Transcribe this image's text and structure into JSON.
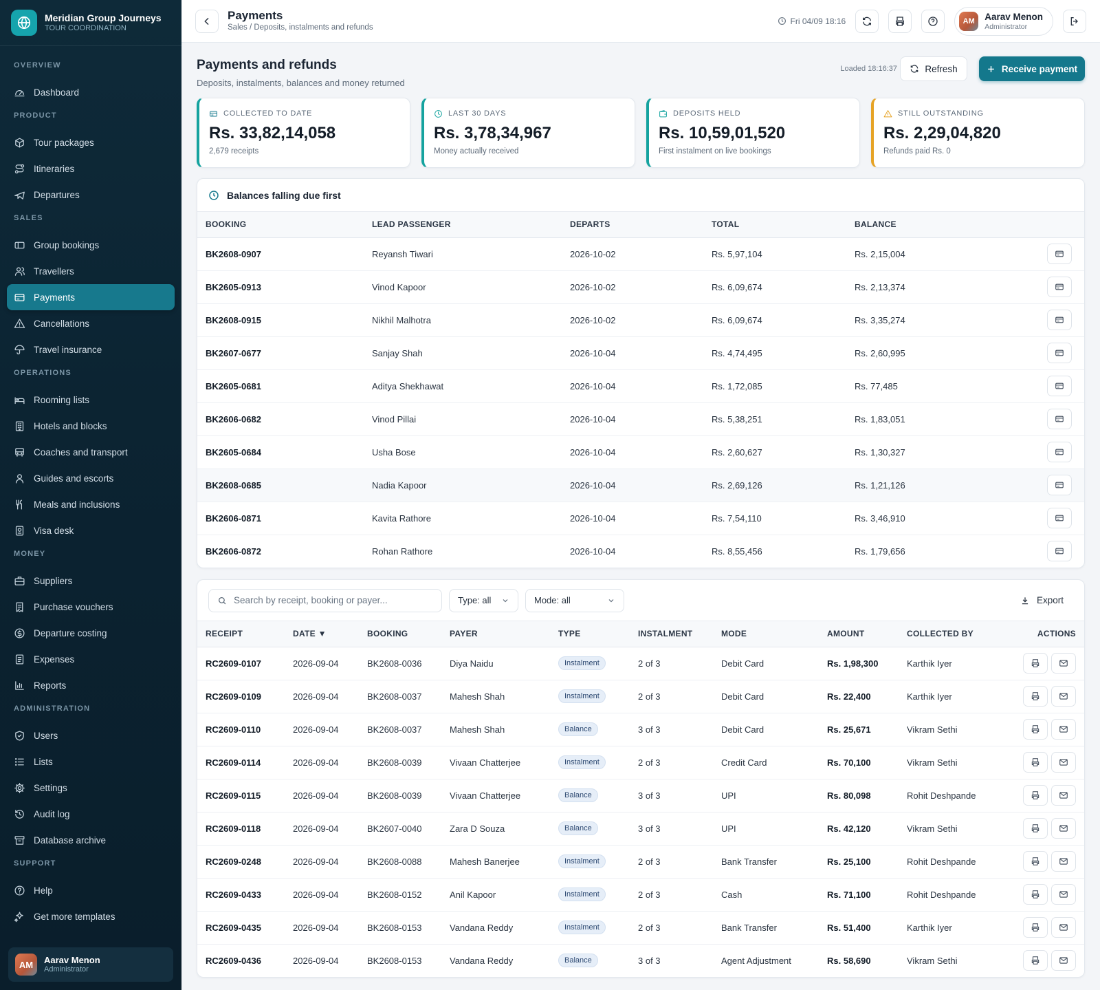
{
  "brand": {
    "name": "Meridian Group Journeys",
    "subtitle": "TOUR COORDINATION"
  },
  "sidebar": {
    "sections": [
      {
        "title": "OVERVIEW",
        "items": [
          {
            "label": "Dashboard",
            "icon": "dashboard-icon"
          }
        ]
      },
      {
        "title": "PRODUCT",
        "items": [
          {
            "label": "Tour packages",
            "icon": "package-icon"
          },
          {
            "label": "Itineraries",
            "icon": "route-icon"
          },
          {
            "label": "Departures",
            "icon": "plane-icon"
          }
        ]
      },
      {
        "title": "SALES",
        "items": [
          {
            "label": "Group bookings",
            "icon": "ticket-icon"
          },
          {
            "label": "Travellers",
            "icon": "users-icon"
          },
          {
            "label": "Payments",
            "icon": "card-icon",
            "active": true
          },
          {
            "label": "Cancellations",
            "icon": "alert-icon"
          },
          {
            "label": "Travel insurance",
            "icon": "umbrella-icon"
          }
        ]
      },
      {
        "title": "OPERATIONS",
        "items": [
          {
            "label": "Rooming lists",
            "icon": "bed-icon"
          },
          {
            "label": "Hotels and blocks",
            "icon": "building-icon"
          },
          {
            "label": "Coaches and transport",
            "icon": "bus-icon"
          },
          {
            "label": "Guides and escorts",
            "icon": "user-icon"
          },
          {
            "label": "Meals and inclusions",
            "icon": "utensils-icon"
          },
          {
            "label": "Visa desk",
            "icon": "passport-icon"
          }
        ]
      },
      {
        "title": "MONEY",
        "items": [
          {
            "label": "Suppliers",
            "icon": "briefcase-icon"
          },
          {
            "label": "Purchase vouchers",
            "icon": "receipt-icon"
          },
          {
            "label": "Departure costing",
            "icon": "coin-icon"
          },
          {
            "label": "Expenses",
            "icon": "document-icon"
          },
          {
            "label": "Reports",
            "icon": "chart-icon"
          }
        ]
      },
      {
        "title": "ADMINISTRATION",
        "items": [
          {
            "label": "Users",
            "icon": "shield-icon"
          },
          {
            "label": "Lists",
            "icon": "list-icon"
          },
          {
            "label": "Settings",
            "icon": "gear-icon"
          },
          {
            "label": "Audit log",
            "icon": "history-icon"
          },
          {
            "label": "Database archive",
            "icon": "archive-icon"
          }
        ]
      },
      {
        "title": "SUPPORT",
        "items": [
          {
            "label": "Help",
            "icon": "help-icon"
          },
          {
            "label": "Get more templates",
            "icon": "sparkle-icon"
          }
        ]
      }
    ]
  },
  "user": {
    "name": "Aarav Menon",
    "role": "Administrator",
    "initials": "AM"
  },
  "topbar": {
    "title": "Payments",
    "breadcrumb": "Sales / Deposits, instalments and refunds",
    "datetime": "Fri 04/09 18:16"
  },
  "page": {
    "title": "Payments and refunds",
    "subtitle": "Deposits, instalments, balances and money returned",
    "loaded": "Loaded 18:16:37",
    "refresh_label": "Refresh",
    "primary_label": "Receive payment"
  },
  "stats": [
    {
      "label": "COLLECTED TO DATE",
      "value": "Rs. 33,82,14,058",
      "note": "2,679 receipts",
      "icon": "card-icon"
    },
    {
      "label": "LAST 30 DAYS",
      "value": "Rs. 3,78,34,967",
      "note": "Money actually received",
      "icon": "clock-icon"
    },
    {
      "label": "DEPOSITS HELD",
      "value": "Rs. 10,59,01,520",
      "note": "First instalment on live bookings",
      "icon": "wallet-icon"
    },
    {
      "label": "STILL OUTSTANDING",
      "value": "Rs. 2,29,04,820",
      "note": "Refunds paid Rs. 0",
      "icon": "warning-icon"
    }
  ],
  "due": {
    "title": "Balances falling due first",
    "columns": [
      "BOOKING",
      "LEAD PASSENGER",
      "DEPARTS",
      "TOTAL",
      "BALANCE",
      ""
    ],
    "rows": [
      [
        "BK2608-0907",
        "Reyansh Tiwari",
        "2026-10-02",
        "Rs. 5,97,104",
        "Rs. 2,15,004"
      ],
      [
        "BK2605-0913",
        "Vinod Kapoor",
        "2026-10-02",
        "Rs. 6,09,674",
        "Rs. 2,13,374"
      ],
      [
        "BK2608-0915",
        "Nikhil Malhotra",
        "2026-10-02",
        "Rs. 6,09,674",
        "Rs. 3,35,274"
      ],
      [
        "BK2607-0677",
        "Sanjay Shah",
        "2026-10-04",
        "Rs. 4,74,495",
        "Rs. 2,60,995"
      ],
      [
        "BK2605-0681",
        "Aditya Shekhawat",
        "2026-10-04",
        "Rs. 1,72,085",
        "Rs. 77,485"
      ],
      [
        "BK2606-0682",
        "Vinod Pillai",
        "2026-10-04",
        "Rs. 5,38,251",
        "Rs. 1,83,051"
      ],
      [
        "BK2605-0684",
        "Usha Bose",
        "2026-10-04",
        "Rs. 2,60,627",
        "Rs. 1,30,327"
      ],
      [
        "BK2608-0685",
        "Nadia Kapoor",
        "2026-10-04",
        "Rs. 2,69,126",
        "Rs. 1,21,126"
      ],
      [
        "BK2606-0871",
        "Kavita Rathore",
        "2026-10-04",
        "Rs. 7,54,110",
        "Rs. 3,46,910"
      ],
      [
        "BK2606-0872",
        "Rohan Rathore",
        "2026-10-04",
        "Rs. 8,55,456",
        "Rs. 1,79,656"
      ]
    ]
  },
  "filters": {
    "search_placeholder": "Search by receipt, booking or payer...",
    "type": "Type: all",
    "mode": "Mode: all",
    "export_label": "Export"
  },
  "payments": {
    "columns": [
      "RECEIPT",
      "DATE ▼",
      "BOOKING",
      "PAYER",
      "TYPE",
      "INSTALMENT",
      "MODE",
      "AMOUNT",
      "COLLECTED BY",
      "ACTIONS"
    ],
    "rows": [
      [
        "RC2609-0107",
        "2026-09-04",
        "BK2608-0036",
        "Diya Naidu",
        "Instalment",
        "2 of 3",
        "Debit Card",
        "Rs. 1,98,300",
        "Karthik Iyer"
      ],
      [
        "RC2609-0109",
        "2026-09-04",
        "BK2608-0037",
        "Mahesh Shah",
        "Instalment",
        "2 of 3",
        "Debit Card",
        "Rs. 22,400",
        "Karthik Iyer"
      ],
      [
        "RC2609-0110",
        "2026-09-04",
        "BK2608-0037",
        "Mahesh Shah",
        "Balance",
        "3 of 3",
        "Debit Card",
        "Rs. 25,671",
        "Vikram Sethi"
      ],
      [
        "RC2609-0114",
        "2026-09-04",
        "BK2608-0039",
        "Vivaan Chatterjee",
        "Instalment",
        "2 of 3",
        "Credit Card",
        "Rs. 70,100",
        "Vikram Sethi"
      ],
      [
        "RC2609-0115",
        "2026-09-04",
        "BK2608-0039",
        "Vivaan Chatterjee",
        "Balance",
        "3 of 3",
        "UPI",
        "Rs. 80,098",
        "Rohit Deshpande"
      ],
      [
        "RC2609-0118",
        "2026-09-04",
        "BK2607-0040",
        "Zara D Souza",
        "Balance",
        "3 of 3",
        "UPI",
        "Rs. 42,120",
        "Vikram Sethi"
      ],
      [
        "RC2609-0248",
        "2026-09-04",
        "BK2608-0088",
        "Mahesh Banerjee",
        "Instalment",
        "2 of 3",
        "Bank Transfer",
        "Rs. 25,100",
        "Rohit Deshpande"
      ],
      [
        "RC2609-0433",
        "2026-09-04",
        "BK2608-0152",
        "Anil Kapoor",
        "Instalment",
        "2 of 3",
        "Cash",
        "Rs. 71,100",
        "Rohit Deshpande"
      ],
      [
        "RC2609-0435",
        "2026-09-04",
        "BK2608-0153",
        "Vandana Reddy",
        "Instalment",
        "2 of 3",
        "Bank Transfer",
        "Rs. 51,400",
        "Karthik Iyer"
      ],
      [
        "RC2609-0436",
        "2026-09-04",
        "BK2608-0153",
        "Vandana Reddy",
        "Balance",
        "3 of 3",
        "Agent Adjustment",
        "Rs. 58,690",
        "Vikram Sethi"
      ]
    ]
  }
}
